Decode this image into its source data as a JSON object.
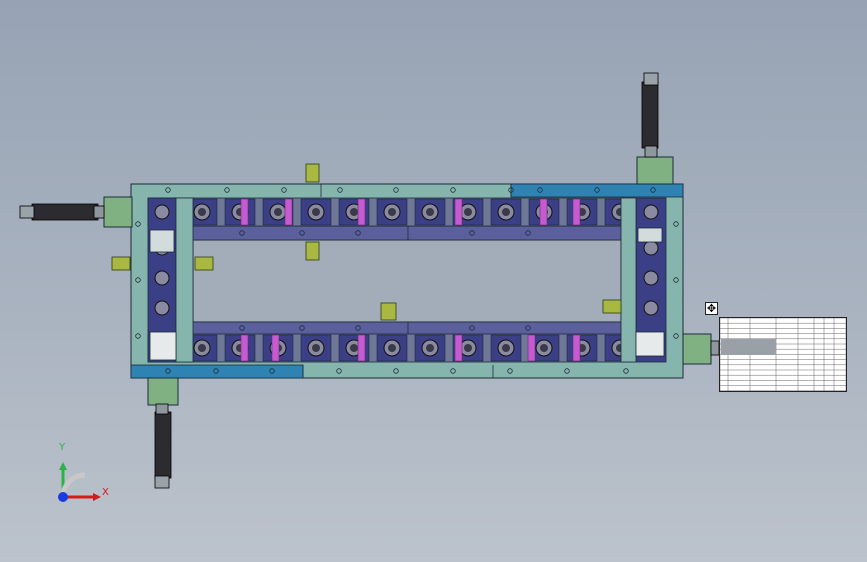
{
  "axes": {
    "x_label": "X",
    "y_label": "Y",
    "x_color": "#d21c1c",
    "y_color": "#2bb34a",
    "z_color": "#1a3be0"
  },
  "colors": {
    "frame": "#86b5ae",
    "frame_blue": "#2f83b2",
    "rail": "#5b5f9c",
    "fixture_block": "#3a3f86",
    "magenta_pin": "#c45bd0",
    "cylinder_block": "#80b183",
    "cylinder_body": "#2c2c30",
    "bracket": "#a8b840",
    "table_border": "#222222"
  },
  "bom": {
    "move_handle_glyph": "✥"
  }
}
